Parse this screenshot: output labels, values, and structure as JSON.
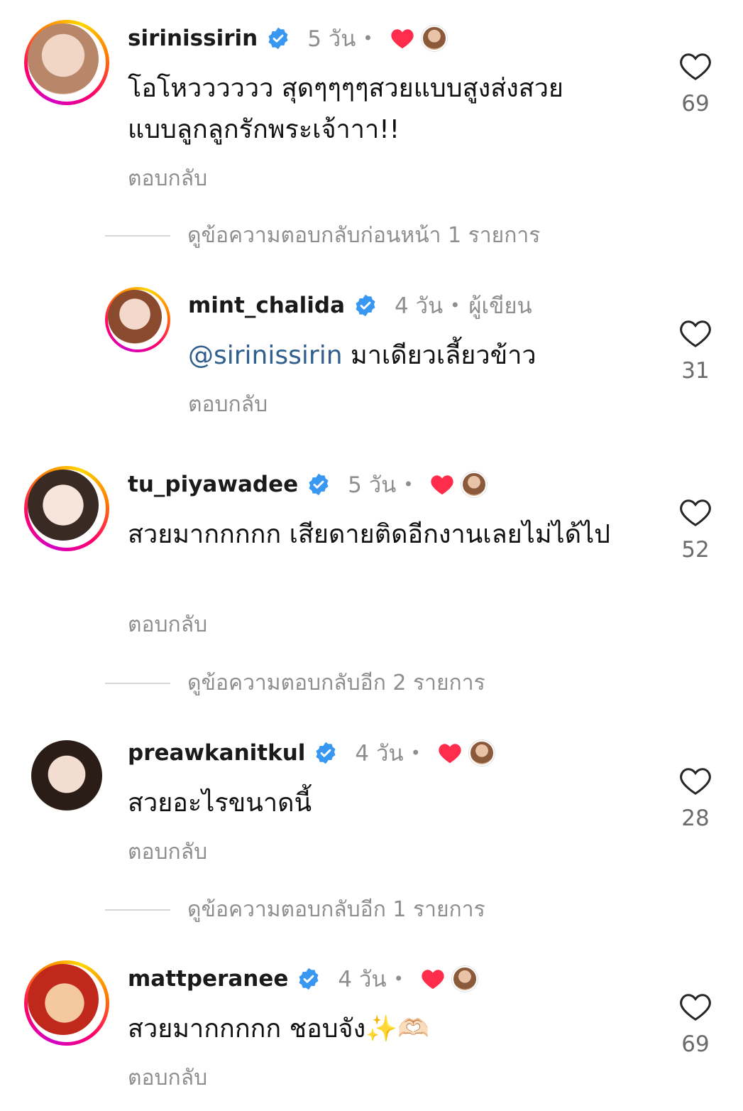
{
  "comments": [
    {
      "username": "sirinissirin",
      "time": "5 วัน",
      "dot": "•",
      "text": "โอโหวววววว สุดๆๆๆๆสวยแบบสูงส่งสวยแบบลูกลูกรักพระเจ้าาา!!",
      "reply": "ตอบกลับ",
      "likes": "69",
      "liked_by_author": true,
      "avatar_colors": [
        "#f1d6c6",
        "#b8876a"
      ]
    },
    {
      "username": "mint_chalida",
      "time": "4 วัน",
      "dot": "•",
      "author_badge": "ผู้เขียน",
      "mention": "@sirinissirin",
      "text": "มาเดียวเลี้ยวข้าว",
      "reply": "ตอบกลับ",
      "likes": "31",
      "avatar_colors": [
        "#f3d9cc",
        "#8a4a2e"
      ]
    },
    {
      "username": "tu_piyawadee",
      "time": "5 วัน",
      "dot": "•",
      "text": "สวยมากกกกก เสียดายติดอีกงานเลยไม่ได้ไป",
      "reply": "ตอบกลับ",
      "likes": "52",
      "liked_by_author": true,
      "avatar_colors": [
        "#f7e4da",
        "#3a2a24"
      ]
    },
    {
      "username": "preawkanitkul",
      "time": "4 วัน",
      "dot": "•",
      "text": "สวยอะไรขนาดนี้",
      "reply": "ตอบกลับ",
      "likes": "28",
      "liked_by_author": true,
      "avatar_colors": [
        "#f3dcd0",
        "#2a1c17"
      ]
    },
    {
      "username": "mattperanee",
      "time": "4 วัน",
      "dot": "•",
      "text": "สวยมากกกกก ชอบจัง✨🫶🏻",
      "reply": "ตอบกลับ",
      "likes": "69",
      "liked_by_author": true,
      "avatar_colors": [
        "#f5c9a0",
        "#c0281c"
      ]
    }
  ],
  "view_replies": [
    {
      "text": "ดูข้อความตอบกลับก่อนหน้า 1 รายการ"
    },
    {
      "text": "ดูข้อความตอบกลับอีก 2 รายการ"
    },
    {
      "text": "ดูข้อความตอบกลับอีก 1 รายการ"
    }
  ],
  "colors": {
    "verified_blue": "#3897f0",
    "like_red": "#ff2d4b",
    "mention_blue": "#2f5f8f",
    "muted_gray": "#8e8e8e"
  },
  "icons": {
    "verified": "verified-badge-icon",
    "heart": "heart-outline-icon",
    "liked": "heart-filled-icon"
  }
}
